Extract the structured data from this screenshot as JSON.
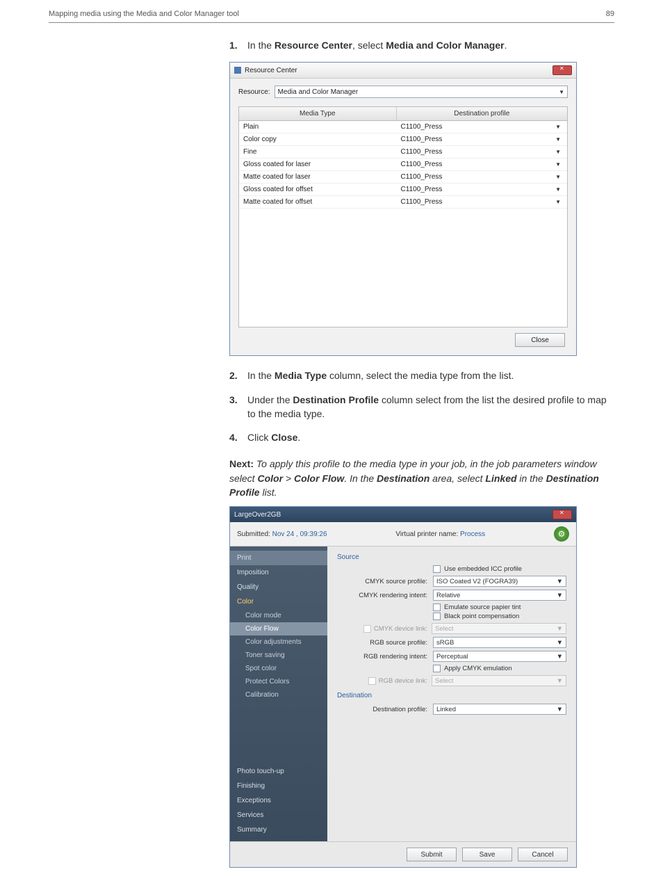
{
  "header": {
    "left": "Mapping media using the Media and Color Manager tool",
    "right": "89"
  },
  "steps": {
    "s1": {
      "num": "1.",
      "pre": "In the ",
      "b1": "Resource Center",
      "mid": ", select ",
      "b2": "Media and Color Manager",
      "post": "."
    },
    "s2": {
      "num": "2.",
      "pre": "In the ",
      "b1": "Media Type",
      "post": " column, select the media type from the list."
    },
    "s3": {
      "num": "3.",
      "pre": "Under the ",
      "b1": "Destination Profile",
      "post": " column select from the list the desired profile to map to the media type."
    },
    "s4": {
      "num": "4.",
      "pre": "Click ",
      "b1": "Close",
      "post": "."
    }
  },
  "next": {
    "lead": "Next: ",
    "i1": "To apply this profile to the media type in your job, in the job parameters window select ",
    "b1": "Color",
    "sep1": " > ",
    "b2": "Color Flow",
    "i2": ". In the ",
    "b3": "Destination",
    "i3": " area, select ",
    "b4": "Linked",
    "i4": " in the ",
    "b5": "Destination Profile",
    "i5": " list."
  },
  "rc": {
    "title": "Resource Center",
    "resource_label": "Resource:",
    "resource_value": "Media and Color Manager",
    "th_media": "Media Type",
    "th_dest": "Destination profile",
    "rows": [
      {
        "media": "Plain",
        "dest": "C1100_Press"
      },
      {
        "media": "Color copy",
        "dest": "C1100_Press"
      },
      {
        "media": "Fine",
        "dest": "C1100_Press"
      },
      {
        "media": "Gloss coated for laser",
        "dest": "C1100_Press"
      },
      {
        "media": "Matte coated for laser",
        "dest": "C1100_Press"
      },
      {
        "media": "Gloss coated for offset",
        "dest": "C1100_Press"
      },
      {
        "media": "Matte coated for offset",
        "dest": "C1100_Press"
      }
    ],
    "close_btn": "Close"
  },
  "jp": {
    "title": "LargeOver2GB",
    "submitted_label": "Submitted: ",
    "submitted_value": "Nov 24 , 09:39:26",
    "vpn_label": "Virtual printer name: ",
    "vpn_value": "Process",
    "cats": {
      "print": "Print",
      "imposition": "Imposition",
      "quality": "Quality",
      "color": "Color",
      "photo": "Photo touch-up",
      "finishing": "Finishing",
      "exceptions": "Exceptions",
      "services": "Services",
      "summary": "Summary"
    },
    "subs": {
      "color_mode": "Color mode",
      "color_flow": "Color Flow",
      "color_adj": "Color adjustments",
      "toner_saving": "Toner saving",
      "spot": "Spot color",
      "protect": "Protect Colors",
      "calibration": "Calibration"
    },
    "source_title": "Source",
    "dest_title": "Destination",
    "fields": {
      "use_embedded": "Use embedded ICC profile",
      "cmyk_src_lbl": "CMYK source profile:",
      "cmyk_src_val": "ISO Coated V2 (FOGRA39)",
      "cmyk_ri_lbl": "CMYK rendering intent:",
      "cmyk_ri_val": "Relative",
      "emulate": "Emulate source papier tint",
      "bpc": "Black point compensation",
      "cmyk_dl_lbl": "CMYK device link:",
      "cmyk_dl_val": "Select",
      "rgb_src_lbl": "RGB source profile:",
      "rgb_src_val": "sRGB",
      "rgb_ri_lbl": "RGB rendering intent:",
      "rgb_ri_val": "Perceptual",
      "apply_cmyk": "Apply CMYK emulation",
      "rgb_dl_lbl": "RGB device link:",
      "rgb_dl_val": "Select",
      "dest_lbl": "Destination profile:",
      "dest_val": "Linked"
    },
    "buttons": {
      "submit": "Submit",
      "save": "Save",
      "cancel": "Cancel"
    }
  }
}
